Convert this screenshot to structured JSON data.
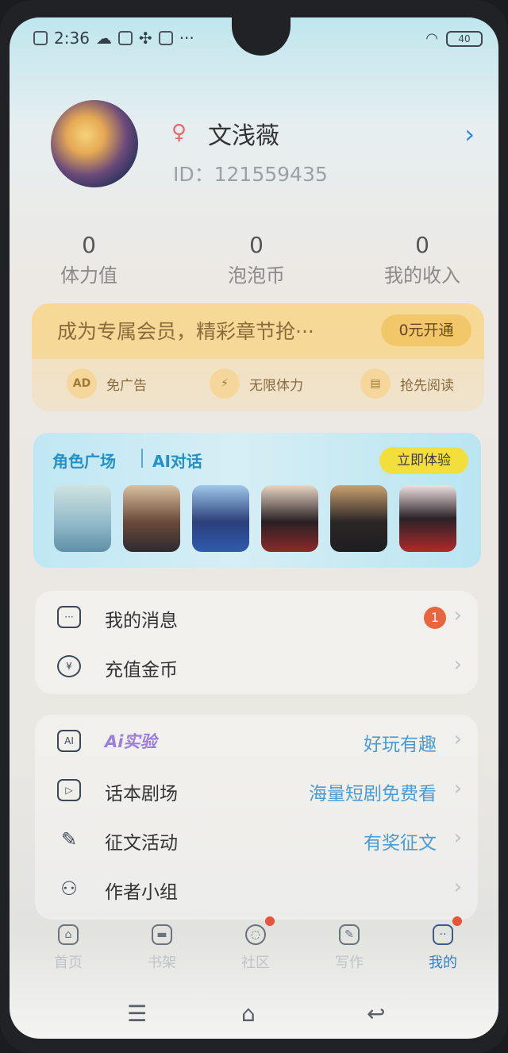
{
  "status_bar": {
    "time": "2:36",
    "battery": "40"
  },
  "profile": {
    "name": "文浅薇",
    "id_text": "ID：121559435"
  },
  "stats": [
    {
      "value": "0",
      "label": "体力值"
    },
    {
      "value": "0",
      "label": "泡泡币"
    },
    {
      "value": "0",
      "label": "我的收入"
    }
  ],
  "vip": {
    "title": "成为专属会员，精彩章节抢···",
    "button": "0元开通",
    "perks": [
      {
        "icon": "AD",
        "label": "免广告"
      },
      {
        "icon": "⚡",
        "label": "无限体力"
      },
      {
        "icon": "▤",
        "label": "抢先阅读"
      }
    ]
  },
  "ai_card": {
    "title": "角色广场",
    "subtitle": "AI对话",
    "button": "立即体验"
  },
  "menu_group1": [
    {
      "label": "我的消息",
      "badge": "1"
    },
    {
      "label": "充值金币"
    }
  ],
  "menu_group2": [
    {
      "label": "Ai实验",
      "value": "好玩有趣"
    },
    {
      "label": "话本剧场",
      "value": "海量短剧免费看"
    },
    {
      "label": "征文活动",
      "value": "有奖征文"
    },
    {
      "label": "作者小组"
    }
  ],
  "tabs": [
    {
      "label": "首页"
    },
    {
      "label": "书架"
    },
    {
      "label": "社区"
    },
    {
      "label": "写作"
    },
    {
      "label": "我的"
    }
  ],
  "colors": {
    "accent": "#2f7fd0",
    "badge": "#e7663d",
    "vip_gold": "#f2c76a",
    "ai_button": "#f2df3b"
  }
}
